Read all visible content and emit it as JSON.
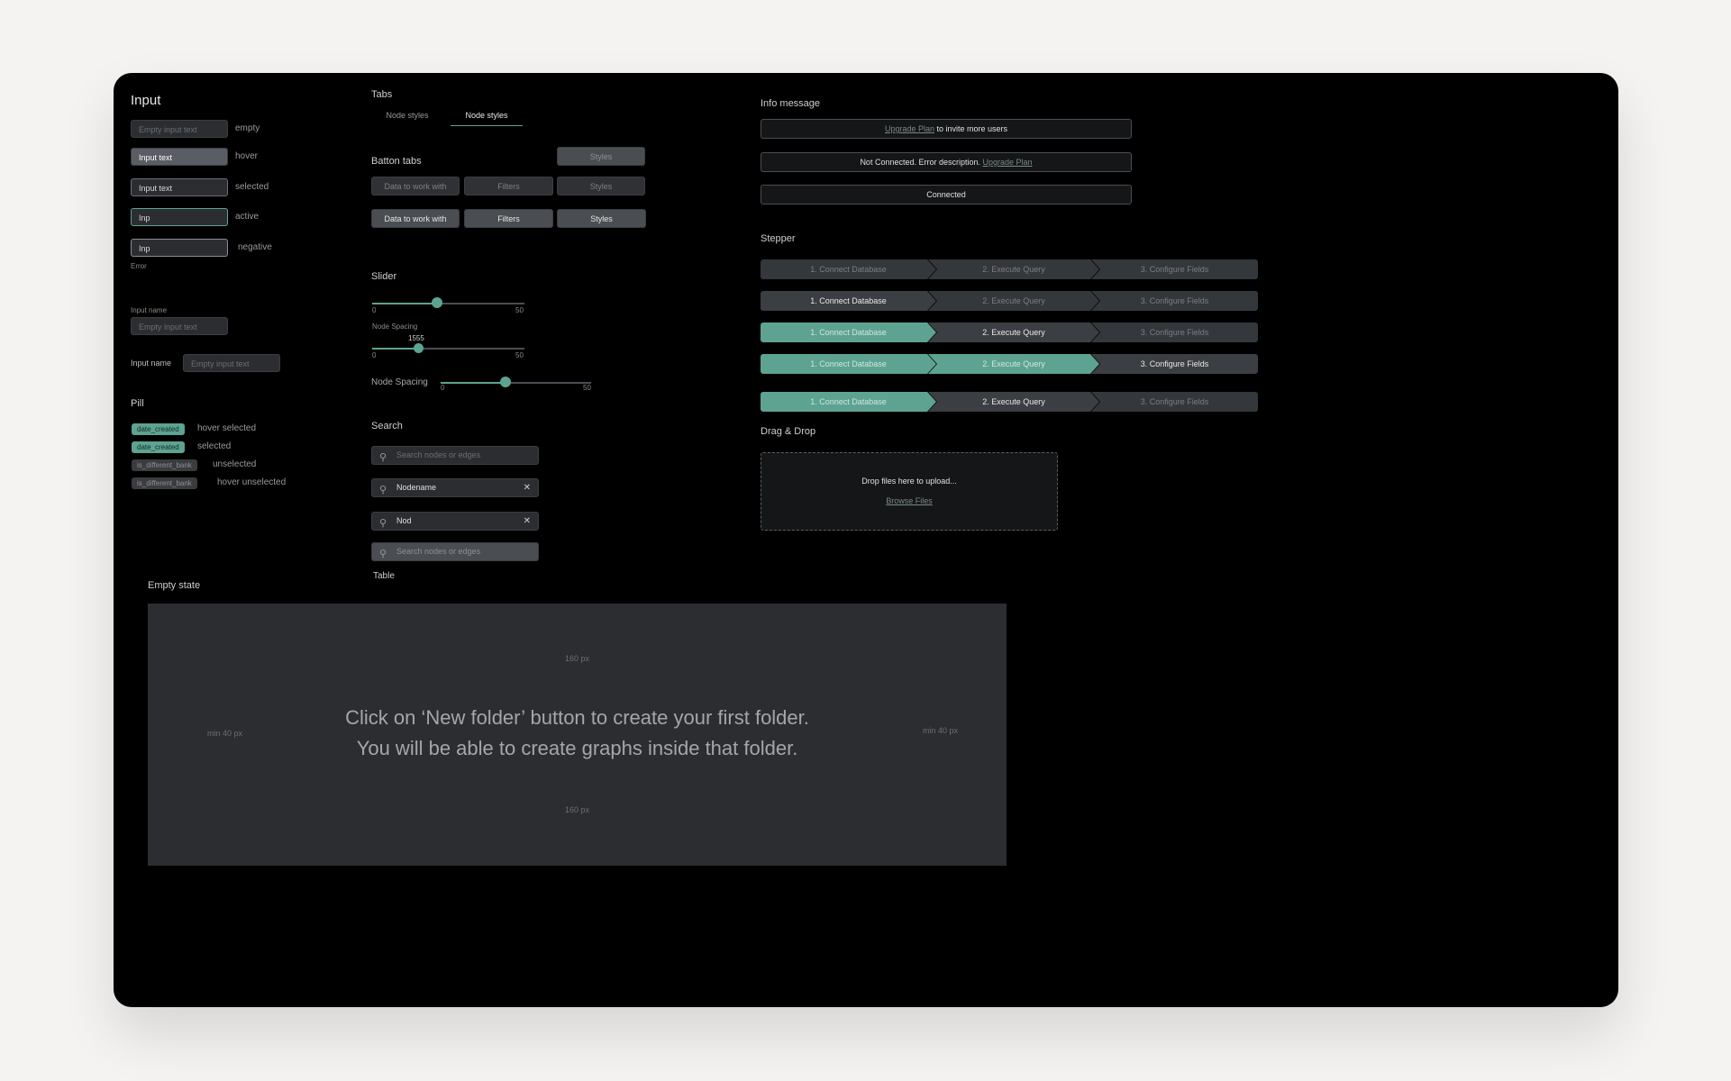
{
  "input": {
    "title": "Input",
    "fields": [
      {
        "value": "Empty input text",
        "state": "empty"
      },
      {
        "value": "Input text",
        "state": "hover"
      },
      {
        "value": "Input text",
        "state": "selected"
      },
      {
        "value": "Inp",
        "state": "active"
      },
      {
        "value": "Inp",
        "state": "negative"
      }
    ],
    "error_text": "Error",
    "label_top": "Input name",
    "label_top_placeholder": "Empty input text",
    "label_left": "Input name",
    "label_left_placeholder": "Empty input text"
  },
  "pill": {
    "title": "Pill",
    "items": [
      {
        "text": "date_created",
        "state": "hover selected"
      },
      {
        "text": "date_created",
        "state": "selected"
      },
      {
        "text": "is_different_bank",
        "state": "unselected"
      },
      {
        "text": "is_different_bank",
        "state": "hover unselected"
      }
    ]
  },
  "tabs": {
    "title": "Tabs",
    "items": [
      "Node styles",
      "Node styles"
    ]
  },
  "button_tabs": {
    "title": "Batton tabs",
    "single": "Styles",
    "row1": [
      "Data to work with",
      "Filters",
      "Styles"
    ],
    "row2": [
      "Data to work with",
      "Filters",
      "Styles"
    ]
  },
  "slider": {
    "title": "Slider",
    "s1": {
      "min": "0",
      "max": "50",
      "value_fraction": 0.5
    },
    "s2": {
      "label": "Node Spacing",
      "value": "1555",
      "min": "0",
      "max": "50",
      "value_fraction": 0.3
    },
    "s3": {
      "label": "Node Spacing",
      "min": "0",
      "max": "50",
      "value_fraction": 0.42
    }
  },
  "search": {
    "title": "Search",
    "placeholder": "Search nodes or edges",
    "value1": "Nodename",
    "value2": "Nod",
    "icon": "search-icon",
    "clear_icon": "close-icon"
  },
  "table_label": "Table",
  "info": {
    "title": "Info message",
    "m1_link": "Upgrade Plan",
    "m1_text": " to invite more users",
    "m2_text": "Not Connected. Error description. ",
    "m2_link": "Upgrade Plan",
    "m3_text": "Connected"
  },
  "stepper": {
    "title": "Stepper",
    "steps": [
      "1. Connect Database",
      "2. Execute Query",
      "3. Configure Fields"
    ]
  },
  "dragdrop": {
    "title": "Drag & Drop",
    "text": "Drop files here to upload...",
    "link": "Browse Files"
  },
  "empty_state": {
    "title": "Empty state",
    "line1": "Click on ‘New folder’ button to create your first folder.",
    "line2": "You will be able to create graphs inside that folder.",
    "top_spacing": "160 px",
    "bottom_spacing": "160 px",
    "left_spacing": "min 40 px",
    "right_spacing": "min 40 px"
  },
  "colors": {
    "accent": "#5ea391",
    "panel": "#000000",
    "field": "#2b2d31"
  }
}
